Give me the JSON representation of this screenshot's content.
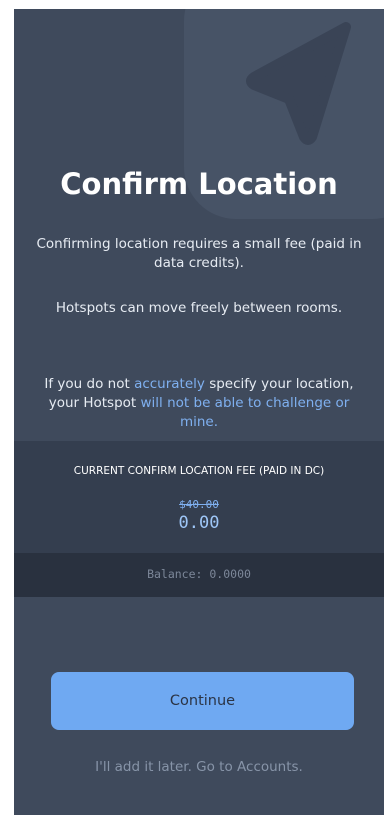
{
  "title": "Confirm Location",
  "paragraph1": "Confirming location requires a small fee (paid in data credits).",
  "paragraph2": "Hotspots can move freely between rooms.",
  "paragraph3": {
    "part1": "If you do not ",
    "link1": "accurately",
    "part2": " specify your location, your Hotspot ",
    "link2": "will not be able to challenge or mine."
  },
  "fee": {
    "label": "CURRENT CONFIRM LOCATION FEE (PAID IN DC)",
    "old_value": "$40.00",
    "value": "0.00"
  },
  "balance": "Balance: 0.0000",
  "buttons": {
    "continue": "Continue",
    "later": "I'll add it later. Go to Accounts."
  },
  "icons": {
    "hero": "location-arrow-icon"
  },
  "colors": {
    "background": "#3f4a5c",
    "accent": "#6fa9f2",
    "link": "#7fb0f0"
  }
}
